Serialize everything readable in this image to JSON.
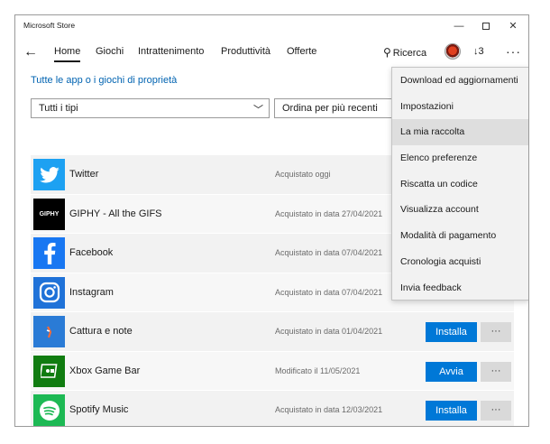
{
  "window": {
    "title": "Microsoft Store"
  },
  "nav": {
    "tabs": [
      {
        "label": "Home",
        "active": true
      },
      {
        "label": "Giochi"
      },
      {
        "label": "Intrattenimento"
      },
      {
        "label": "Produttività"
      },
      {
        "label": "Offerte"
      }
    ],
    "search_label": "Ricerca",
    "downloads_label": "3",
    "more_label": "···"
  },
  "content": {
    "owned_link": "Tutte le app o i giochi di proprietà",
    "filter_type": "Tutti i tipi",
    "filter_sort": "Ordina per più recenti"
  },
  "apps": [
    {
      "name": "Twitter",
      "status": "Acquistato oggi",
      "icon": "twitter-icon",
      "color": "#1da1f2"
    },
    {
      "name": "GIPHY - All the GIFS",
      "status": "Acquistato in data 27/04/2021",
      "icon": "giphy-icon",
      "color": "#000000",
      "icon_text": "GIPHY"
    },
    {
      "name": "Facebook",
      "status": "Acquistato in data 07/04/2021",
      "icon": "facebook-icon",
      "color": "#1877f2"
    },
    {
      "name": "Instagram",
      "status": "Acquistato in data 07/04/2021",
      "icon": "instagram-icon",
      "color": "#1f72d8"
    },
    {
      "name": "Cattura e note",
      "status": "Acquistato in data 01/04/2021",
      "icon": "snip-sketch-icon",
      "color": "#2a7bd6",
      "action": "Installa"
    },
    {
      "name": "Xbox Game Bar",
      "status": "Modificato il 11/05/2021",
      "icon": "xbox-game-bar-icon",
      "color": "#107c10",
      "action": "Avvia"
    },
    {
      "name": "Spotify Music",
      "status": "Acquistato in data 12/03/2021",
      "icon": "spotify-icon",
      "color": "#1db954",
      "action": "Installa"
    }
  ],
  "row_more_label": "···",
  "menu": {
    "items": [
      {
        "label": "Download ed aggiornamenti"
      },
      {
        "label": "Impostazioni"
      },
      {
        "label": "La mia raccolta",
        "highlight": true
      },
      {
        "label": "Elenco preferenze"
      },
      {
        "label": "Riscatta un codice"
      },
      {
        "label": "Visualizza account"
      },
      {
        "label": "Modalità di pagamento"
      },
      {
        "label": "Cronologia acquisti"
      },
      {
        "label": "Invia feedback"
      }
    ]
  },
  "colors": {
    "accent": "#0078d7",
    "link": "#0063b1"
  }
}
